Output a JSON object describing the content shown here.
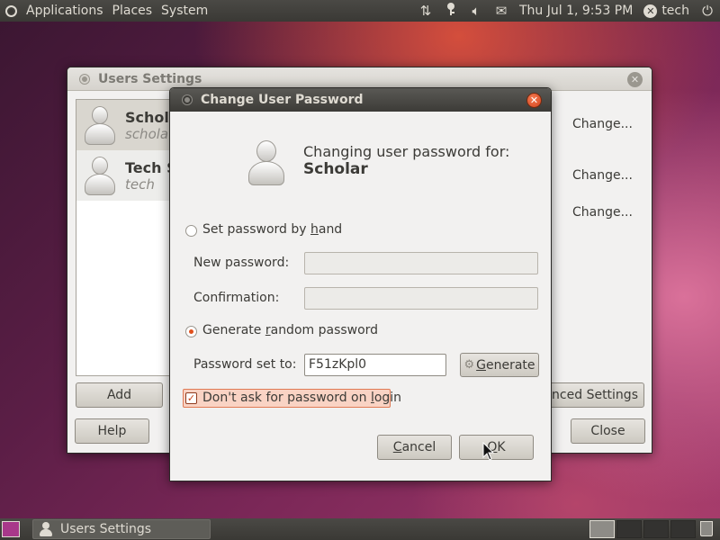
{
  "top_panel": {
    "menus": [
      "Applications",
      "Places",
      "System"
    ],
    "clock": "Thu Jul  1,  9:53 PM",
    "user": "tech"
  },
  "users_window": {
    "title": "Users Settings",
    "users": [
      {
        "name": "Schola",
        "login": "schola"
      },
      {
        "name": "Tech S",
        "login": "tech"
      }
    ],
    "change_links": [
      "Change...",
      "Change...",
      "Change..."
    ],
    "add_label": "Add",
    "help_label": "Help",
    "advanced_label": "anced Settings",
    "close_label": "Close"
  },
  "dialog": {
    "title": "Change User Password",
    "heading": "Changing user password for:",
    "user_name": "Scholar",
    "set_by_hand_pre": "Set password by ",
    "set_by_hand_ul": "h",
    "set_by_hand_post": "and",
    "new_password_label": "New password:",
    "new_password_value": "",
    "confirmation_label": "Confirmation:",
    "confirmation_value": "",
    "generate_random_pre": "Generate ",
    "generate_random_ul": "r",
    "generate_random_post": "andom password",
    "password_set_label": "Password set to:",
    "password_value": "F51zKpl0",
    "generate_btn_ul": "G",
    "generate_btn_rest": "enerate",
    "dont_ask_pre": "Don't ask for password on ",
    "dont_ask_ul": "l",
    "dont_ask_post": "ogin",
    "dont_ask_checked": true,
    "selected_option": "generate_random",
    "cancel_ul": "C",
    "cancel_rest": "ancel",
    "ok_ul": "O",
    "ok_rest": "K"
  },
  "bottom_panel": {
    "task_label": "Users Settings"
  },
  "colors": {
    "accent": "#e0501d",
    "panel": "#3c3b37",
    "window_bg": "#f2f1f0"
  }
}
